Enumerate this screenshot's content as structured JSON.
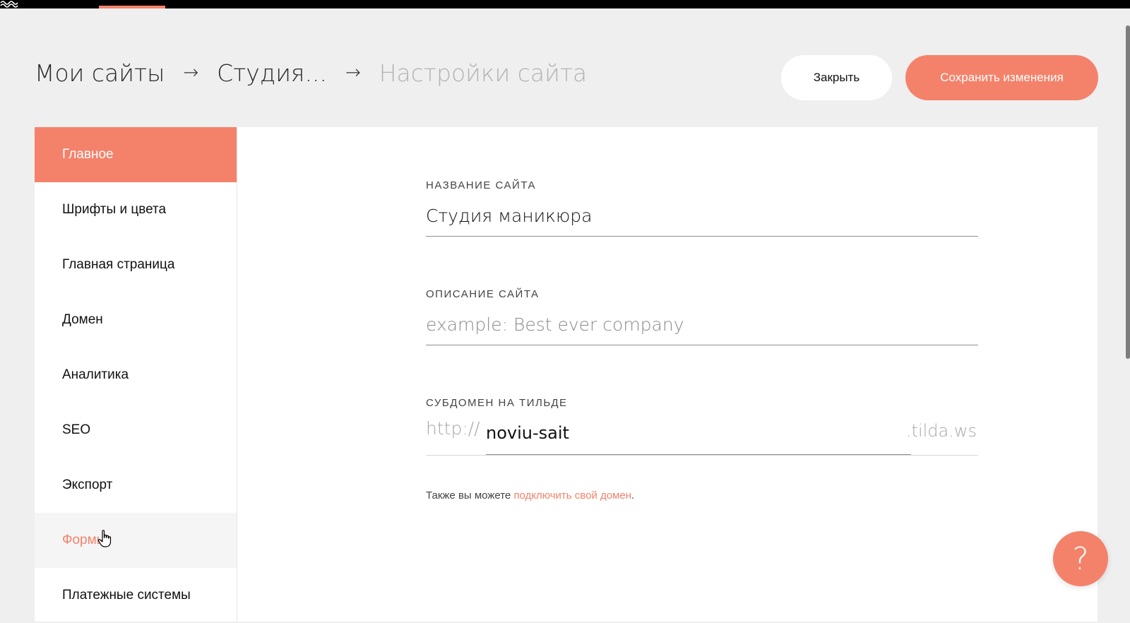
{
  "breadcrumb": {
    "my_sites": "Мои сайты",
    "arrow": "→",
    "project": "Студия...",
    "current": "Настройки сайта"
  },
  "buttons": {
    "close_label": "Закрыть",
    "save_label": "Сохранить изменения"
  },
  "sidebar": {
    "items": [
      {
        "label": "Главное",
        "state": "active"
      },
      {
        "label": "Шрифты и цвета",
        "state": "normal"
      },
      {
        "label": "Главная страница",
        "state": "normal"
      },
      {
        "label": "Домен",
        "state": "normal"
      },
      {
        "label": "Аналитика",
        "state": "normal"
      },
      {
        "label": "SEO",
        "state": "normal"
      },
      {
        "label": "Экспорт",
        "state": "normal"
      },
      {
        "label": "Формы",
        "state": "hover"
      },
      {
        "label": "Платежные системы",
        "state": "normal"
      }
    ]
  },
  "form": {
    "site_name_label": "НАЗВАНИЕ САЙТА",
    "site_name_value": "Студия маникюра",
    "site_description_label": "ОПИСАНИЕ САЙТА",
    "site_description_placeholder": "example: Best ever company",
    "subdomain_label": "СУБДОМЕН НА ТИЛЬДЕ",
    "subdomain_prefix": "http://",
    "subdomain_value": "noviu-sait",
    "subdomain_suffix": ".tilda.ws",
    "hint_text": "Также вы можете ",
    "hint_link": "подключить свой домен",
    "hint_end": "."
  },
  "help": {
    "label": "?"
  },
  "colors": {
    "accent": "#f4826a",
    "background": "#efefef",
    "topbar": "#000000"
  },
  "icons": {
    "logo": "tilda-wave-logo",
    "cursor": "hand-pointer-icon"
  }
}
